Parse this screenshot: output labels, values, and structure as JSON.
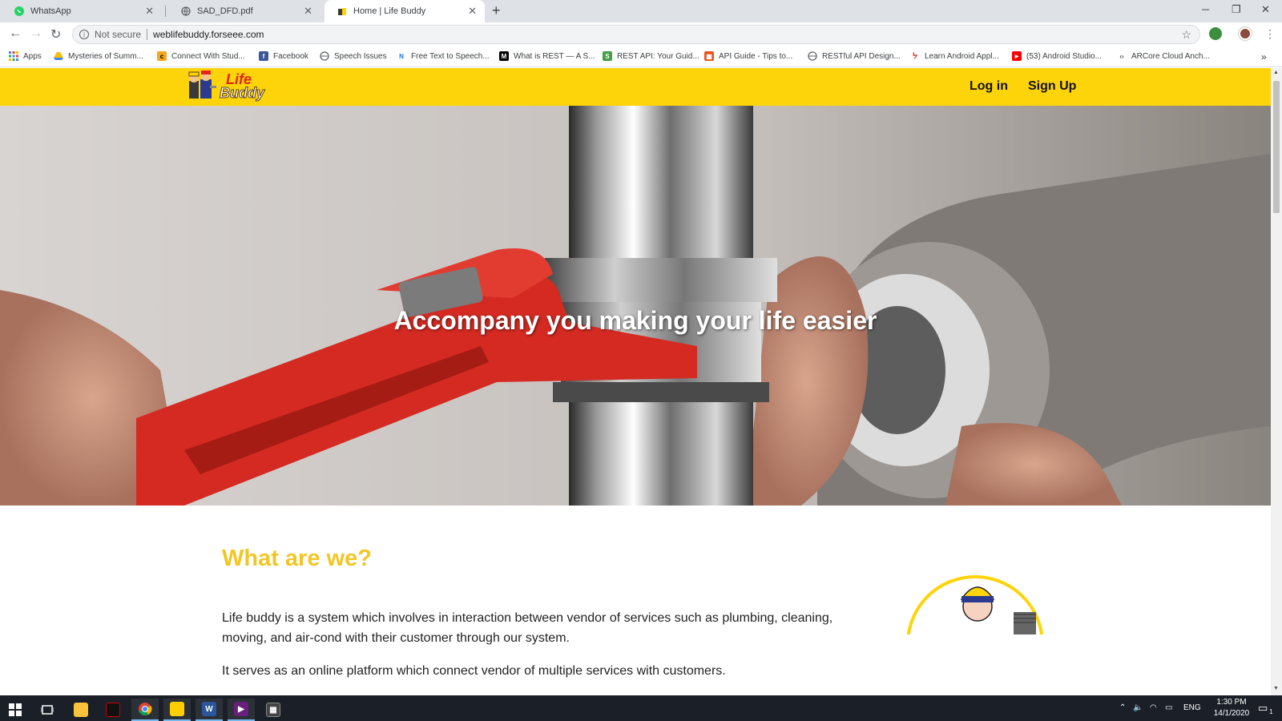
{
  "browser": {
    "tabs": [
      {
        "title": "WhatsApp",
        "icon": "whatsapp-icon",
        "active": false
      },
      {
        "title": "SAD_DFD.pdf",
        "icon": "globe-icon",
        "active": false
      },
      {
        "title": "Home | Life Buddy",
        "icon": "lifebuddy-favicon",
        "active": true
      }
    ],
    "address": {
      "security_label": "Not secure",
      "url": "weblifebuddy.forseee.com"
    },
    "bookmarks": [
      {
        "label": "Apps",
        "icon": "apps-grid-icon"
      },
      {
        "label": "Mysteries of Summ...",
        "icon": "drive-icon"
      },
      {
        "label": "Connect With Stud...",
        "icon": "chegg-icon"
      },
      {
        "label": "Facebook",
        "icon": "facebook-icon"
      },
      {
        "label": "Speech Issues",
        "icon": "globe-icon"
      },
      {
        "label": "Free Text to Speech...",
        "icon": "naturalreader-icon"
      },
      {
        "label": "What is REST — A S...",
        "icon": "medium-icon"
      },
      {
        "label": "REST API: Your Guid...",
        "icon": "rest-icon"
      },
      {
        "label": "API Guide - Tips to...",
        "icon": "api-icon"
      },
      {
        "label": "RESTful API Design...",
        "icon": "globe-icon"
      },
      {
        "label": "Learn Android Appl...",
        "icon": "android-icon"
      },
      {
        "label": "(53) Android Studio...",
        "icon": "youtube-icon"
      },
      {
        "label": "ARCore Cloud Anch...",
        "icon": "code-icon"
      }
    ]
  },
  "site": {
    "logo_line1": "Life",
    "logo_line2": "Buddy",
    "nav": {
      "login": "Log in",
      "signup": "Sign Up"
    },
    "hero_title": "Accompany you making your life easier",
    "section_title": "What are we?",
    "paragraphs": [
      "Life buddy is a system which involves in interaction between vendor of services such as plumbing, cleaning, moving, and air-cond with their customer through our system.",
      "It serves as an online platform which connect vendor of multiple services with customers."
    ]
  },
  "taskbar": {
    "apps": [
      "start-icon",
      "task-view-icon",
      "file-explorer-icon",
      "app-icon",
      "chrome-icon",
      "sticky-notes-icon",
      "word-icon",
      "visual-studio-icon",
      "calculator-icon"
    ],
    "language": "ENG",
    "time": "1:30 PM",
    "date": "14/1/2020",
    "notification_count": "1"
  },
  "colors": {
    "brand_yellow": "#fdd309",
    "title_yellow": "#f2c624",
    "wrench_red": "#d42a22"
  }
}
